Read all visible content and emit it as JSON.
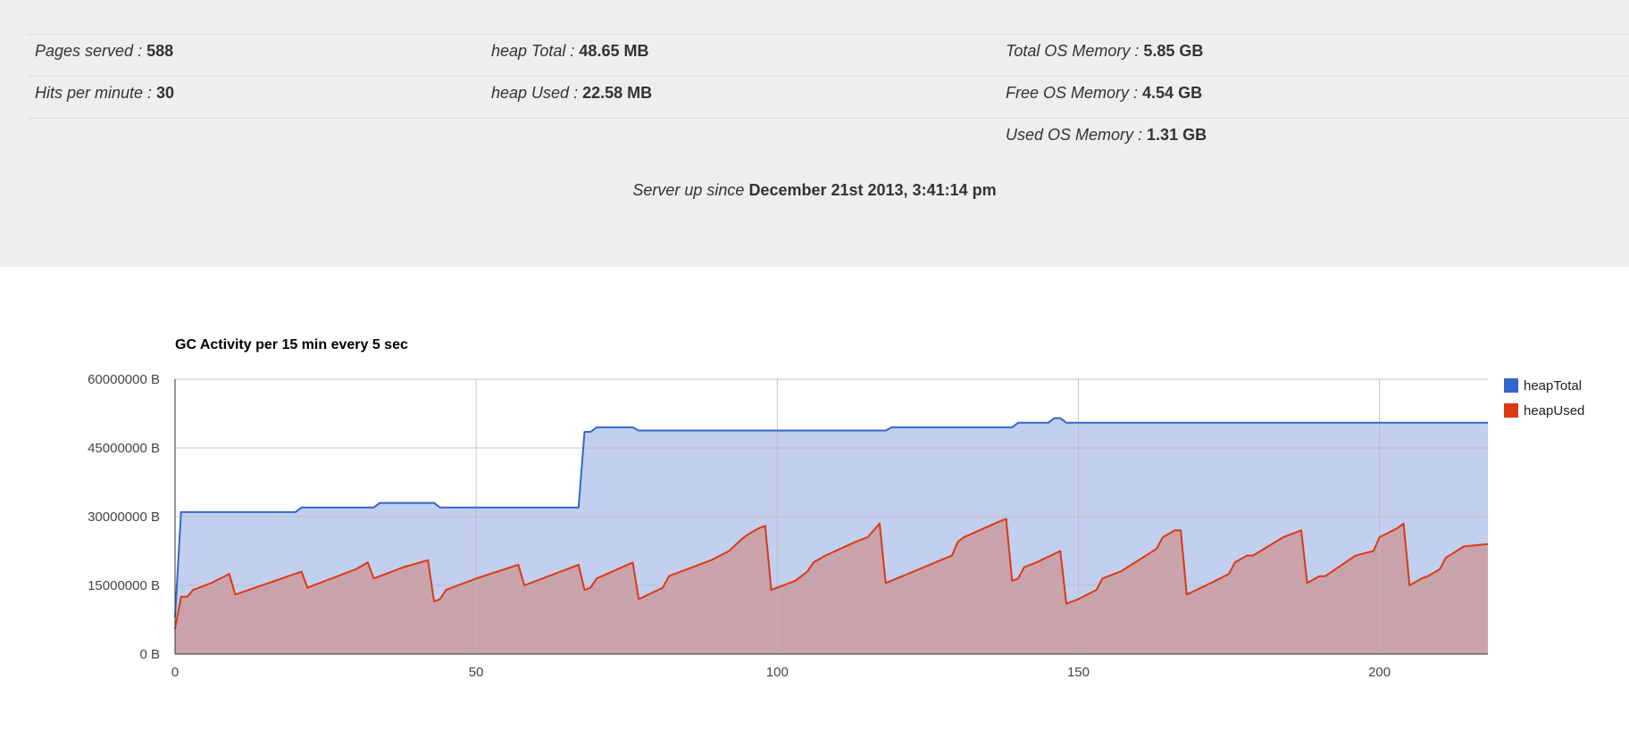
{
  "stats": {
    "pages_served": {
      "label": "Pages served : ",
      "value": "588"
    },
    "hits_per_minute": {
      "label": "Hits per minute : ",
      "value": "30"
    },
    "heap_total": {
      "label": "heap Total : ",
      "value": "48.65 MB"
    },
    "heap_used": {
      "label": "heap Used : ",
      "value": "22.58 MB"
    },
    "total_os_memory": {
      "label": "Total OS Memory : ",
      "value": "5.85 GB"
    },
    "free_os_memory": {
      "label": "Free OS Memory : ",
      "value": "4.54 GB"
    },
    "used_os_memory": {
      "label": "Used OS Memory : ",
      "value": "1.31 GB"
    }
  },
  "uptime": {
    "label": "Server up since ",
    "value": "December 21st 2013, 3:41:14 pm"
  },
  "chart_data": {
    "type": "area",
    "title": "GC Activity per 15 min every 5 sec",
    "xlabel": "",
    "ylabel": "",
    "xlim": [
      0,
      218
    ],
    "ylim": [
      0,
      60000000
    ],
    "y_unit_suffix": " B",
    "y_ticks": [
      0,
      15000000,
      30000000,
      45000000,
      60000000
    ],
    "x_ticks": [
      0,
      50,
      100,
      150,
      200
    ],
    "grid": true,
    "legend_position": "right",
    "series": [
      {
        "name": "heapTotal",
        "color": "#3366cc",
        "fill": "#c2cfee",
        "points": [
          [
            0,
            8000000
          ],
          [
            1,
            31000000
          ],
          [
            20,
            31000000
          ],
          [
            21,
            32000000
          ],
          [
            33,
            32000000
          ],
          [
            34,
            33000000
          ],
          [
            43,
            33000000
          ],
          [
            44,
            32000000
          ],
          [
            67,
            32000000
          ],
          [
            68,
            48500000
          ],
          [
            69,
            48500000
          ],
          [
            70,
            49500000
          ],
          [
            76,
            49500000
          ],
          [
            77,
            48800000
          ],
          [
            118,
            48800000
          ],
          [
            119,
            49500000
          ],
          [
            139,
            49500000
          ],
          [
            140,
            50500000
          ],
          [
            145,
            50500000
          ],
          [
            146,
            51500000
          ],
          [
            147,
            51500000
          ],
          [
            148,
            50500000
          ],
          [
            218,
            50500000
          ]
        ]
      },
      {
        "name": "heapUsed",
        "color": "#dc3912",
        "fill": "#c9a2ab",
        "points": [
          [
            0,
            5500000
          ],
          [
            1,
            12500000
          ],
          [
            2,
            12500000
          ],
          [
            3,
            14000000
          ],
          [
            6,
            15500000
          ],
          [
            9,
            17500000
          ],
          [
            10,
            13000000
          ],
          [
            21,
            18000000
          ],
          [
            22,
            14500000
          ],
          [
            30,
            18500000
          ],
          [
            32,
            20000000
          ],
          [
            33,
            16500000
          ],
          [
            38,
            19000000
          ],
          [
            42,
            20500000
          ],
          [
            43,
            11500000
          ],
          [
            44,
            12000000
          ],
          [
            45,
            14000000
          ],
          [
            50,
            16500000
          ],
          [
            57,
            19500000
          ],
          [
            58,
            15000000
          ],
          [
            67,
            19500000
          ],
          [
            68,
            14000000
          ],
          [
            69,
            14500000
          ],
          [
            70,
            16500000
          ],
          [
            76,
            20000000
          ],
          [
            77,
            12000000
          ],
          [
            81,
            14500000
          ],
          [
            82,
            17000000
          ],
          [
            89,
            20500000
          ],
          [
            92,
            22500000
          ],
          [
            94,
            25000000
          ],
          [
            95,
            26000000
          ],
          [
            97,
            27500000
          ],
          [
            98,
            28000000
          ],
          [
            99,
            14000000
          ],
          [
            103,
            16000000
          ],
          [
            104,
            17000000
          ],
          [
            105,
            18000000
          ],
          [
            106,
            20000000
          ],
          [
            108,
            21500000
          ],
          [
            113,
            24500000
          ],
          [
            115,
            25500000
          ],
          [
            117,
            28500000
          ],
          [
            118,
            15500000
          ],
          [
            129,
            21500000
          ],
          [
            130,
            24500000
          ],
          [
            131,
            25500000
          ],
          [
            137,
            29000000
          ],
          [
            138,
            29500000
          ],
          [
            139,
            16000000
          ],
          [
            140,
            16500000
          ],
          [
            141,
            19000000
          ],
          [
            143,
            20000000
          ],
          [
            147,
            22500000
          ],
          [
            148,
            11000000
          ],
          [
            149,
            11500000
          ],
          [
            150,
            12000000
          ],
          [
            153,
            14000000
          ],
          [
            154,
            16500000
          ],
          [
            155,
            17000000
          ],
          [
            157,
            18000000
          ],
          [
            160,
            20500000
          ],
          [
            163,
            23000000
          ],
          [
            164,
            25500000
          ],
          [
            166,
            27000000
          ],
          [
            167,
            27000000
          ],
          [
            168,
            13000000
          ],
          [
            172,
            15500000
          ],
          [
            175,
            17500000
          ],
          [
            176,
            20000000
          ],
          [
            178,
            21500000
          ],
          [
            179,
            21500000
          ],
          [
            184,
            25500000
          ],
          [
            187,
            27000000
          ],
          [
            188,
            15500000
          ],
          [
            190,
            17000000
          ],
          [
            191,
            17000000
          ],
          [
            196,
            21500000
          ],
          [
            199,
            22500000
          ],
          [
            200,
            25500000
          ],
          [
            203,
            27500000
          ],
          [
            204,
            28500000
          ],
          [
            205,
            15000000
          ],
          [
            207,
            16500000
          ],
          [
            208,
            17000000
          ],
          [
            210,
            18500000
          ],
          [
            211,
            21000000
          ],
          [
            214,
            23500000
          ],
          [
            218,
            24000000
          ]
        ]
      }
    ]
  }
}
